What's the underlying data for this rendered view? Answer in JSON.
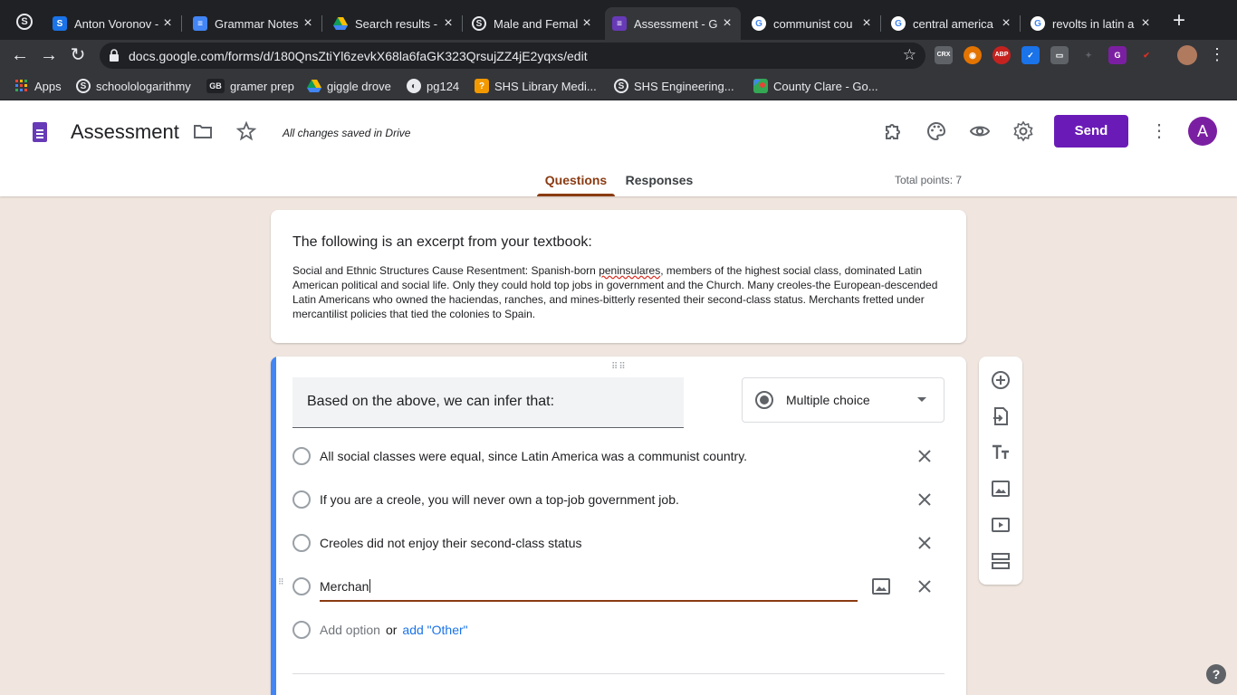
{
  "browser": {
    "tabs": [
      {
        "title": "Anton Voronov -",
        "icon": "skype-icon",
        "color": "#1a73e8"
      },
      {
        "title": "Grammar Notes",
        "icon": "docs-icon",
        "color": "#4285f4"
      },
      {
        "title": "Search results -",
        "icon": "drive-icon",
        "color": "#fbbc04"
      },
      {
        "title": "Male and Femal",
        "icon": "schoology-icon",
        "color": "#e8eaed"
      },
      {
        "title": "Assessment - G",
        "icon": "forms-icon",
        "color": "#673ab7"
      },
      {
        "title": "communist cou",
        "icon": "google-icon",
        "color": "#ffffff"
      },
      {
        "title": "central america",
        "icon": "google-icon",
        "color": "#ffffff"
      },
      {
        "title": "revolts in latin a",
        "icon": "google-icon",
        "color": "#ffffff"
      }
    ],
    "url": "docs.google.com/forms/d/180QnsZtiYl6zevkX68la6faGK323QrsujZZ4jE2yqxs/edit",
    "bookmarks": [
      {
        "label": "Apps",
        "icon": "apps-grid-icon"
      },
      {
        "label": "schoolologarithmy",
        "icon": "schoology-icon"
      },
      {
        "label": "gramer prep",
        "icon": "gb-icon"
      },
      {
        "label": "giggle drove",
        "icon": "drive-icon"
      },
      {
        "label": "pg124",
        "icon": "globe-icon"
      },
      {
        "label": "SHS Library Medi...",
        "icon": "library-icon"
      },
      {
        "label": "SHS Engineering...",
        "icon": "schoology-icon"
      },
      {
        "label": "County Clare - Go...",
        "icon": "maps-icon"
      }
    ]
  },
  "form": {
    "title": "Assessment",
    "saved_status": "All changes saved in Drive",
    "send_label": "Send",
    "avatar_letter": "A",
    "tabs": {
      "questions": "Questions",
      "responses": "Responses"
    },
    "total_points": "Total points: 7",
    "accent_color": "#6a1bb7"
  },
  "description": {
    "title": "The following is an excerpt from your textbook:",
    "body_before": "Social and Ethnic Structures Cause Resentment: Spanish-born ",
    "body_misspelled": "peninsulares",
    "body_after": ", members of the highest social class, dominated Latin American political and social life. Only they could hold top jobs in government and the Church. Many creoles-the European-descended Latin Americans who owned the haciendas, ranches, and mines-bitterly resented their second-class status. Merchants fretted under mercantilist policies that tied the colonies to Spain."
  },
  "question": {
    "title": "Based on the above, we can infer that:",
    "type": "Multiple choice",
    "options": [
      "All social classes were equal, since Latin America was a communist country.",
      "If you are a creole, you will never own a top-job government job.",
      "Creoles did not enjoy their second-class status",
      "Merchan"
    ],
    "add_option": "Add option",
    "or": "or",
    "add_other": "add \"Other\""
  }
}
